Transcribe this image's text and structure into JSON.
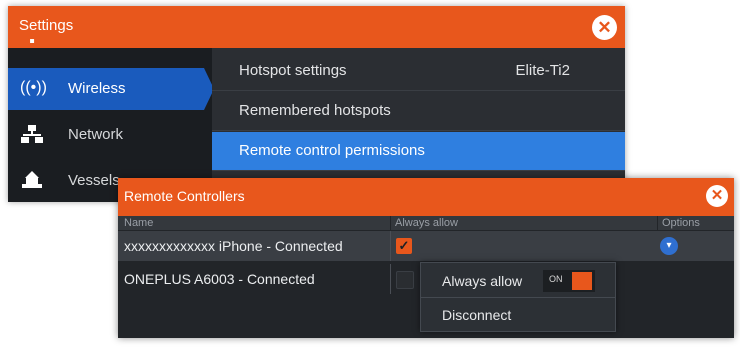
{
  "settings": {
    "title": "Settings",
    "close_icon": "close-circle-icon",
    "sidebar": {
      "items": [
        {
          "label": "",
          "icon": "partial-icon"
        },
        {
          "label": "Wireless",
          "icon": "wireless-icon",
          "active": true
        },
        {
          "label": "Network",
          "icon": "network-icon"
        },
        {
          "label": "Vessels",
          "icon": "vessel-icon"
        }
      ]
    },
    "panel": {
      "items": [
        {
          "label": "Hotspot settings",
          "value": "Elite-Ti2"
        },
        {
          "label": "Remembered hotspots",
          "value": ""
        },
        {
          "label": "Remote control permissions",
          "value": "",
          "selected": true
        }
      ]
    }
  },
  "remote": {
    "title": "Remote Controllers",
    "close_icon": "close-circle-icon",
    "columns": {
      "name": "Name",
      "always_allow": "Always allow",
      "options": "Options"
    },
    "rows": [
      {
        "name": "xxxxxxxxxxxxx iPhone - Connected",
        "always_allow": true
      },
      {
        "name": "ONEPLUS A6003 - Connected",
        "always_allow": false
      }
    ],
    "popup": {
      "always_allow_label": "Always allow",
      "toggle_label": "ON",
      "disconnect_label": "Disconnect"
    }
  },
  "colors": {
    "accent": "#e8571c",
    "selection_blue": "#2f7fe0",
    "active_blue": "#1a5bbd",
    "dark_bg": "#1d2024"
  }
}
